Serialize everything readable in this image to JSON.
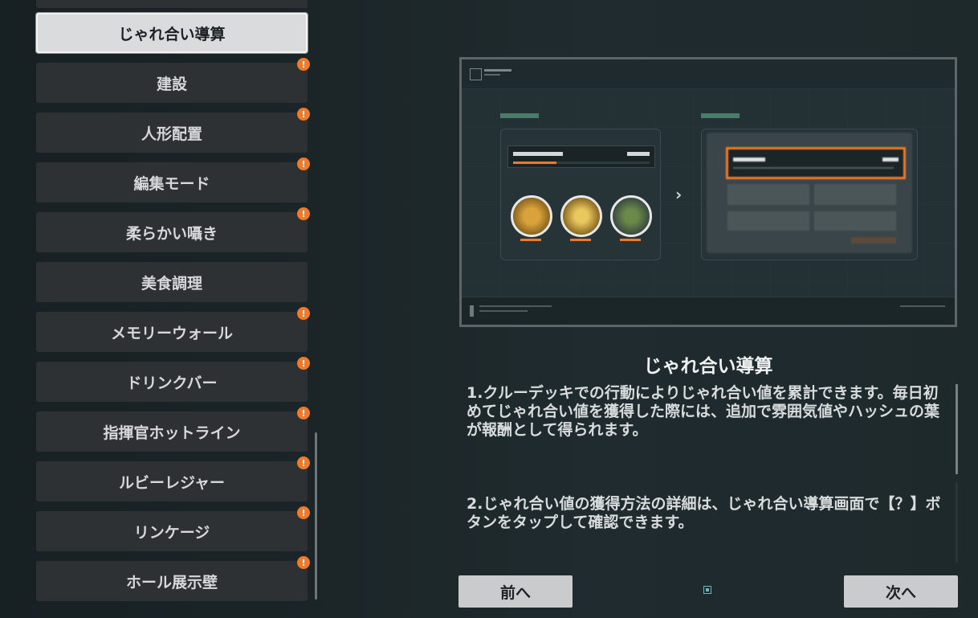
{
  "sidebar": {
    "items": [
      {
        "label": "じゃれ合い導算",
        "active": true,
        "badge": false
      },
      {
        "label": "建設",
        "active": false,
        "badge": true
      },
      {
        "label": "人形配置",
        "active": false,
        "badge": true
      },
      {
        "label": "編集モード",
        "active": false,
        "badge": true
      },
      {
        "label": "柔らかい囁き",
        "active": false,
        "badge": true
      },
      {
        "label": "美食調理",
        "active": false,
        "badge": false
      },
      {
        "label": "メモリーウォール",
        "active": false,
        "badge": true
      },
      {
        "label": "ドリンクバー",
        "active": false,
        "badge": true
      },
      {
        "label": "指揮官ホットライン",
        "active": false,
        "badge": true
      },
      {
        "label": "ルビーレジャー",
        "active": false,
        "badge": true
      },
      {
        "label": "リンケージ",
        "active": false,
        "badge": true
      },
      {
        "label": "ホール展示壁",
        "active": false,
        "badge": true
      }
    ],
    "badge_symbol": "!"
  },
  "content": {
    "title": "じゃれ合い導算",
    "paragraph1": "1.クルーデッキでの行動によりじゃれ合い値を累計できます。毎日初めてじゃれ合い値を獲得した際には、追加で雰囲気値やハッシュの葉が報酬として得られます。",
    "paragraph2": "2.じゃれ合い値の獲得方法の詳細は、じゃれ合い導算画面で【？】ボタンをタップして確認できます。"
  },
  "nav": {
    "prev_label": "前へ",
    "next_label": "次へ"
  },
  "colors": {
    "badge": "#f07a2a",
    "highlight": "#f07a2a",
    "page_indicator": "#6fb7c0"
  }
}
